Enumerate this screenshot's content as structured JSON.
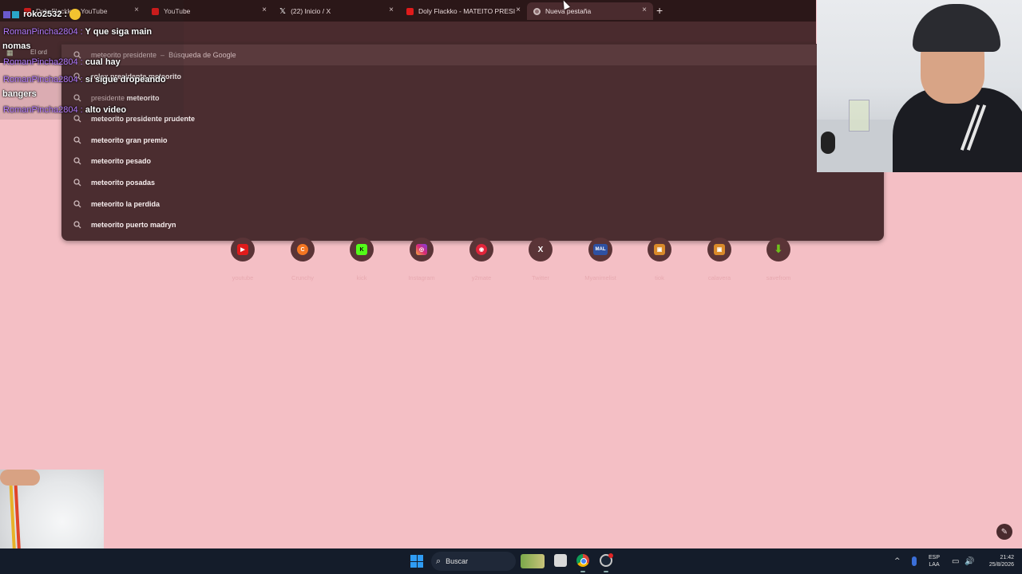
{
  "browser": {
    "tabs": [
      {
        "label": "Doly Flackko - YouTube",
        "favicon": "youtube-icon",
        "active": false
      },
      {
        "label": "YouTube",
        "favicon": "youtube-icon",
        "active": false
      },
      {
        "label": "(22) Inicio / X",
        "favicon": "x-icon",
        "active": false
      },
      {
        "label": "Doly Flackko - MATEITO PRESI",
        "favicon": "youtube-icon",
        "active": false
      },
      {
        "label": "Nueva pestaña",
        "favicon": "chrome-icon",
        "active": true
      }
    ],
    "tab_close_glyph": "×",
    "new_tab_glyph": "+",
    "bookmark_label": "El ord"
  },
  "omnibox": {
    "suggestions": [
      {
        "prefix": "meteorito presidente",
        "suffix_bold": "",
        "separator": "–",
        "secondary": "Búsqueda de Google"
      },
      {
        "prefix": "",
        "suffix_bold": "rolex presidente meteorito",
        "separator": "",
        "secondary": ""
      },
      {
        "prefix": "presidente ",
        "suffix_bold": "meteorito",
        "separator": "",
        "secondary": ""
      },
      {
        "prefix": "meteorito presidente ",
        "suffix_bold": "prudente",
        "separator": "",
        "secondary": ""
      },
      {
        "prefix": "",
        "suffix_bold": "meteorito gran premio",
        "separator": "",
        "secondary": ""
      },
      {
        "prefix": "",
        "suffix_bold": "meteorito pesado",
        "separator": "",
        "secondary": ""
      },
      {
        "prefix": "",
        "suffix_bold": "meteorito posadas",
        "separator": "",
        "secondary": ""
      },
      {
        "prefix": "",
        "suffix_bold": "meteorito la perdida",
        "separator": "",
        "secondary": ""
      },
      {
        "prefix": "",
        "suffix_bold": "meteorito puerto madryn",
        "separator": "",
        "secondary": ""
      }
    ]
  },
  "shortcuts": [
    {
      "label": "youtube",
      "icon": "youtube-icon",
      "color": "#e01b1b",
      "glyph": "▶"
    },
    {
      "label": "Crunchy",
      "icon": "crunchyroll-icon",
      "color": "#f47521",
      "glyph": "C"
    },
    {
      "label": "kick",
      "icon": "kick-icon",
      "color": "#53fc18",
      "glyph": "K"
    },
    {
      "label": "Instagram",
      "icon": "instagram-icon",
      "color": "#d62976",
      "glyph": "◎"
    },
    {
      "label": "y2mate",
      "icon": "y2mate-icon",
      "color": "#e0243a",
      "glyph": "◉"
    },
    {
      "label": "Twitter",
      "icon": "x-icon",
      "color": "#5a3437",
      "glyph": "X"
    },
    {
      "label": "Myanimelist",
      "icon": "mal-icon",
      "color": "#2e51a2",
      "glyph": "MAL"
    },
    {
      "label": "tiok",
      "icon": "tiok-icon",
      "color": "#d98a2a",
      "glyph": "▣"
    },
    {
      "label": "calavera",
      "icon": "calavera-icon",
      "color": "#d98a2a",
      "glyph": "▣"
    },
    {
      "label": "savefrom",
      "icon": "download-icon",
      "color": "#6fc21b",
      "glyph": "⬇"
    }
  ],
  "chat": {
    "messages": [
      {
        "user": "roko2532 :",
        "text": "",
        "emote": true
      },
      {
        "user": "RomanPincha2804 :",
        "text": "Y que siga main"
      },
      {
        "user": "",
        "text": "nomas"
      },
      {
        "user": "RomanPincha2804 :",
        "text": "cual hay"
      },
      {
        "user": "RomanPincha2804 :",
        "text": "si sigue dropeando"
      },
      {
        "user": "",
        "text": "bangers"
      },
      {
        "user": "RomanPincha2804 :",
        "text": "alto video"
      }
    ]
  },
  "edit_glyph": "✎",
  "taskbar": {
    "search_label": "Buscar",
    "search_icon": "⌕",
    "tray_chevron": "^",
    "lang_line1": "ESP",
    "lang_line2": "LAA",
    "net_glyph": "▭",
    "vol_glyph": "🔊",
    "time": "21:42",
    "date": "25/8/2026"
  }
}
